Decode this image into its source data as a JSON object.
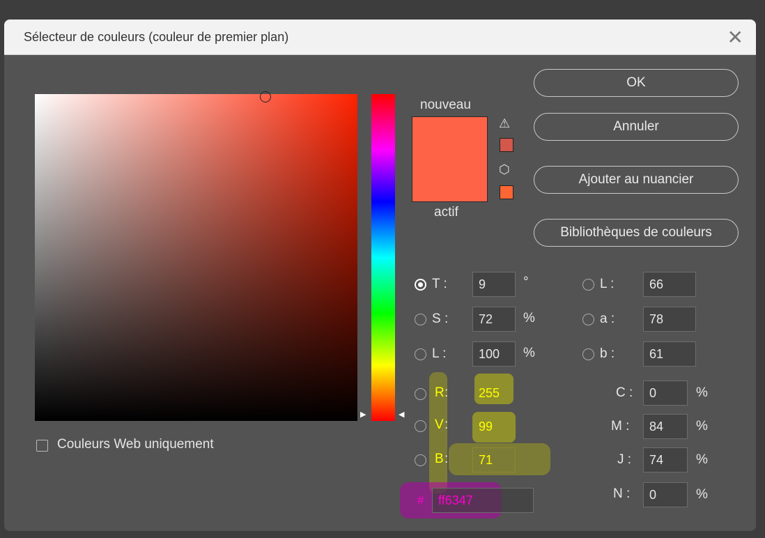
{
  "window": {
    "title": "Sélecteur de couleurs (couleur de premier plan)",
    "close_glyph": "✕"
  },
  "preview": {
    "new_label": "nouveau",
    "current_label": "actif",
    "new_color": "#ff6347",
    "current_color": "#ff6347"
  },
  "gamut": {
    "warning_icon": "warning-triangle-icon",
    "gamut_swatch": "#d3574a",
    "websafe_icon": "cube-icon",
    "websafe_swatch": "#ff6633"
  },
  "buttons": {
    "ok": "OK",
    "cancel": "Annuler",
    "add_swatch": "Ajouter au nuancier",
    "libraries": "Bibliothèques de couleurs"
  },
  "hsb": [
    {
      "label": "T :",
      "value": "9",
      "unit": "°",
      "selected": true
    },
    {
      "label": "S :",
      "value": "72",
      "unit": "%",
      "selected": false
    },
    {
      "label": "L :",
      "value": "100",
      "unit": "%",
      "selected": false
    }
  ],
  "rgb": [
    {
      "letter": "R",
      "sep": " :",
      "value": "255"
    },
    {
      "letter": "V",
      "sep": " :",
      "value": "99"
    },
    {
      "letter": "B",
      "sep": " :",
      "value": "71"
    }
  ],
  "lab": [
    {
      "label": "L :",
      "value": "66"
    },
    {
      "label": "a :",
      "value": "78"
    },
    {
      "label": "b :",
      "value": "61"
    }
  ],
  "cmyk": [
    {
      "label": "C :",
      "value": "0",
      "unit": "%"
    },
    {
      "label": "M :",
      "value": "84",
      "unit": "%"
    },
    {
      "label": "J :",
      "value": "74",
      "unit": "%"
    },
    {
      "label": "N :",
      "value": "0",
      "unit": "%"
    }
  ],
  "hex": {
    "prefix": "#",
    "value": "ff6347"
  },
  "web_only": {
    "label": "Couleurs Web uniquement",
    "checked": false
  },
  "colors": {
    "highlight_yellow": "#ffff00",
    "highlight_magenta": "#ff00cc",
    "base_hue": "#ff2200"
  }
}
